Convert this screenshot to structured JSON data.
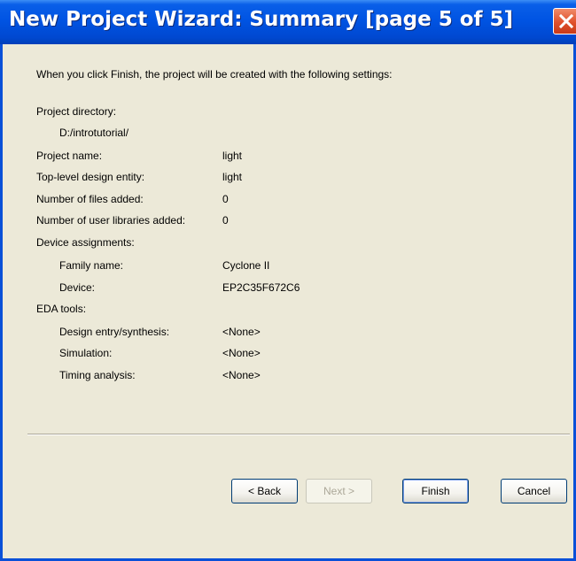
{
  "window": {
    "title": "New Project Wizard: Summary [page 5 of 5]"
  },
  "intro": "When you click Finish, the project will be created with the following settings:",
  "project_directory": {
    "label": "Project directory:",
    "value": "D:/introtutorial/"
  },
  "settings": [
    {
      "label": "Project name:",
      "value": "light"
    },
    {
      "label": "Top-level design entity:",
      "value": "light"
    },
    {
      "label": "Number of files added:",
      "value": "0"
    },
    {
      "label": "Number of user libraries added:",
      "value": "0"
    }
  ],
  "device_assignments": {
    "label": "Device assignments:",
    "items": [
      {
        "label": "Family name:",
        "value": "Cyclone II"
      },
      {
        "label": "Device:",
        "value": "EP2C35F672C6"
      }
    ]
  },
  "eda_tools": {
    "label": "EDA tools:",
    "items": [
      {
        "label": "Design entry/synthesis:",
        "value": "<None>"
      },
      {
        "label": "Simulation:",
        "value": "<None>"
      },
      {
        "label": "Timing analysis:",
        "value": "<None>"
      }
    ]
  },
  "buttons": {
    "back": "< Back",
    "next": "Next >",
    "finish": "Finish",
    "cancel": "Cancel"
  },
  "colors": {
    "titlebar": "#0054e3",
    "dialog_bg": "#ece9d8",
    "close_button": "#e0502c"
  }
}
